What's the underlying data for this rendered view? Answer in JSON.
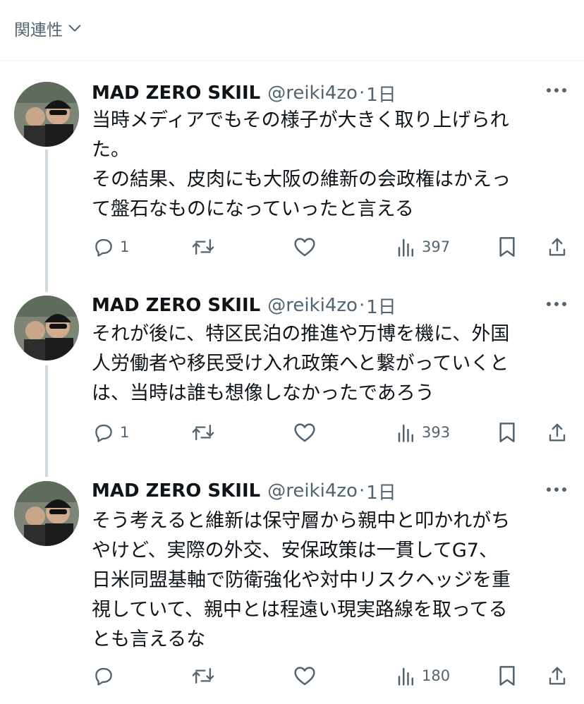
{
  "header": {
    "sort_label": "関連性"
  },
  "tweets": [
    {
      "name": "MAD ZERO SKIIL",
      "handle": "@reiki4zo",
      "dot": "·",
      "time": "1日",
      "lines": [
        "当時メディアでもその様子が大きく取り上げられ",
        "た。",
        "その結果、皮肉にも大阪の維新の会政権はかえっ",
        "て盤石なものになっていったと言える"
      ],
      "replies": "1",
      "reposts": "",
      "likes": "",
      "views": "397"
    },
    {
      "name": "MAD ZERO SKIIL",
      "handle": "@reiki4zo",
      "dot": "·",
      "time": "1日",
      "lines": [
        "それが後に、特区民泊の推進や万博を機に、外国",
        "人労働者や移民受け入れ政策へと繋がっていくと",
        "は、当時は誰も想像しなかったであろう"
      ],
      "replies": "1",
      "reposts": "",
      "likes": "",
      "views": "393"
    },
    {
      "name": "MAD ZERO SKIIL",
      "handle": "@reiki4zo",
      "dot": "·",
      "time": "1日",
      "lines": [
        "そう考えると維新は保守層から親中と叩かれがち",
        "やけど、実際の外交、安保政策は一貫してG7、",
        "日米同盟基軸で防衛強化や対中リスクヘッジを重",
        "視していて、親中とは程遠い現実路線を取ってる",
        "とも言えるな"
      ],
      "replies": "",
      "reposts": "",
      "likes": "",
      "views": "180"
    }
  ],
  "icons": {
    "sort": "chevron-down-icon",
    "more": "more-dots-icon",
    "reply": "reply-icon",
    "repost": "repost-icon",
    "like": "heart-icon",
    "views": "views-bar-icon",
    "bookmark": "bookmark-icon",
    "share": "share-icon"
  },
  "colors": {
    "text": "#0f1419",
    "secondary": "#536471",
    "thread_line": "#cfd9de",
    "divider": "#eff3f4"
  }
}
